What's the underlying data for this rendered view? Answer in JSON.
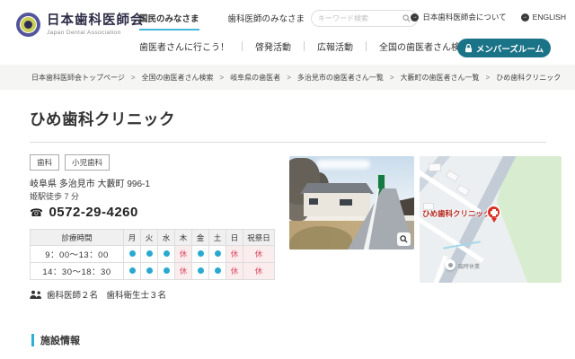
{
  "header": {
    "logo": {
      "title": "日本歯科医師会",
      "subtitle": "Japan Dental Association"
    },
    "top_nav": [
      {
        "label": "国民のみなさま",
        "active": true
      },
      {
        "label": "歯科医師のみなさま",
        "active": false
      }
    ],
    "search": {
      "placeholder": "キーワード検索"
    },
    "utility_links": [
      {
        "label": "日本歯科医師会について"
      },
      {
        "label": "ENGLISH"
      }
    ],
    "main_nav": [
      "歯医者さんに行こう！",
      "啓発活動",
      "広報活動",
      "全国の歯医者さん検索"
    ],
    "members_button": "メンバーズルーム"
  },
  "breadcrumb": [
    "日本歯科医師会トップページ",
    "全国の歯医者さん検索",
    "岐阜県の歯医者",
    "多治見市の歯医者さん一覧",
    "大藪町の歯医者さん一覧",
    "ひめ歯科クリニック"
  ],
  "clinic": {
    "name": "ひめ歯科クリニック",
    "tags": [
      "歯科",
      "小児歯科"
    ],
    "address": "岐阜県 多治見市 大藪町 996-1",
    "access": "姫駅徒歩 7 分",
    "phone": "0572-29-4260",
    "staff": "歯科医師２名　歯科衛生士３名"
  },
  "hours_table": {
    "header": [
      "診療時間",
      "月",
      "火",
      "水",
      "木",
      "金",
      "土",
      "日",
      "祝祭日"
    ],
    "rows": [
      {
        "time": "9：00～13：00",
        "days": [
          "open",
          "open",
          "open",
          "closed",
          "open",
          "open",
          "closed",
          "closed"
        ]
      },
      {
        "time": "14：30～18：30",
        "days": [
          "open",
          "open",
          "open",
          "closed",
          "open",
          "open",
          "closed",
          "closed"
        ]
      }
    ],
    "closed_label": "休"
  },
  "map": {
    "pin_label": "ひめ歯科クリニック",
    "poi_label": "臨時休業"
  },
  "section": {
    "title": "施設情報"
  },
  "colors": {
    "brand_teal": "#1a7387",
    "accent_blue": "#45b5dc",
    "open_dot": "#29a9d2",
    "closed_red": "#d84a5f",
    "closed_bg": "#fbecee",
    "pin_red": "#d93025"
  }
}
